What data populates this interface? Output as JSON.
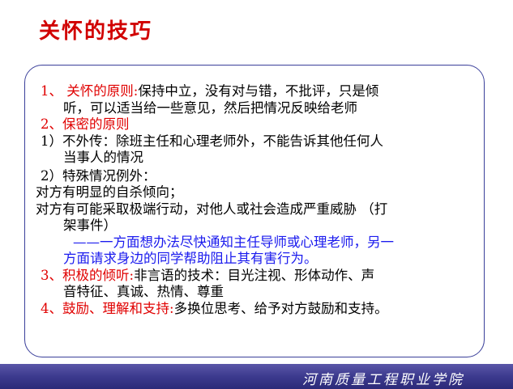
{
  "title": "关怀的技巧",
  "items": {
    "p1_num": "1、",
    "p1_head": "关怀的原则:",
    "p1_line1": "保持中立，没有对与错，不批评，只是倾",
    "p1_line2": "听，可以适当给一些意见，然后把情况反映给老师",
    "p2_head": "2、保密的原则",
    "p3_line1": "1）不外传：除班主任和心理老师外，不能告诉其他任何人",
    "p3_line2": "当事人的情况",
    "p4": "2）特殊情况例外：",
    "p5": "对方有明显的自杀倾向；",
    "p6_line1": "对方有可能采取极端行动，对他人或社会造成严重威胁 （打",
    "p6_line2": "架事件）",
    "p7_line1": "——一方面想办法尽快通知主任导师或心理老师，另一",
    "p7_line2": "方面请求身边的同学帮助阻止其有害行为。",
    "p8_head": "3、积极的倾听:",
    "p8_line1": "非言语的技术：目光注视、形体动作、声",
    "p8_line2": "音特征、真诚、热情、尊重",
    "p9_head": "4、鼓励、理解和支持:",
    "p9_body": "多换位思考、给予对方鼓励和支持。"
  },
  "footer": "河南质量工程职业学院"
}
